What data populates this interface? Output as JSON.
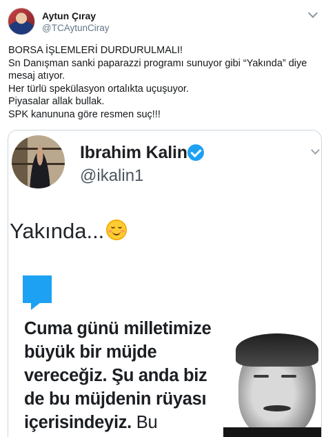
{
  "tweet": {
    "author_name": "Aytun Çıray",
    "author_handle": "@TCAytunCiray",
    "lines": [
      "BORSA İŞLEMLERİ DURDURULMALI!",
      "Sn Danışman sanki paparazzi programı sunuyor gibi “Yakında” diye",
      "mesaj atıyor.",
      "Her türlü spekülasyon ortalıkta uçuşuyor.",
      "Piyasalar allak bullak.",
      "SPK kanununa göre resmen suç!!!"
    ]
  },
  "embedded": {
    "name": "Ibrahim Kalin",
    "handle": "@ikalin1",
    "text": "Yakında...",
    "emoji": "smiling-face-icon",
    "quote_lines": [
      "Cuma günü milletimize",
      "büyük bir müjde",
      "vereceğiz. Şu anda biz",
      "de bu müjdenin rüyası",
      "içerisindeyiz."
    ],
    "quote_tail": "Bu"
  },
  "colors": {
    "accent": "#1da1f2",
    "text": "#14171a",
    "muted": "#657786",
    "border": "#ccd6dd"
  }
}
